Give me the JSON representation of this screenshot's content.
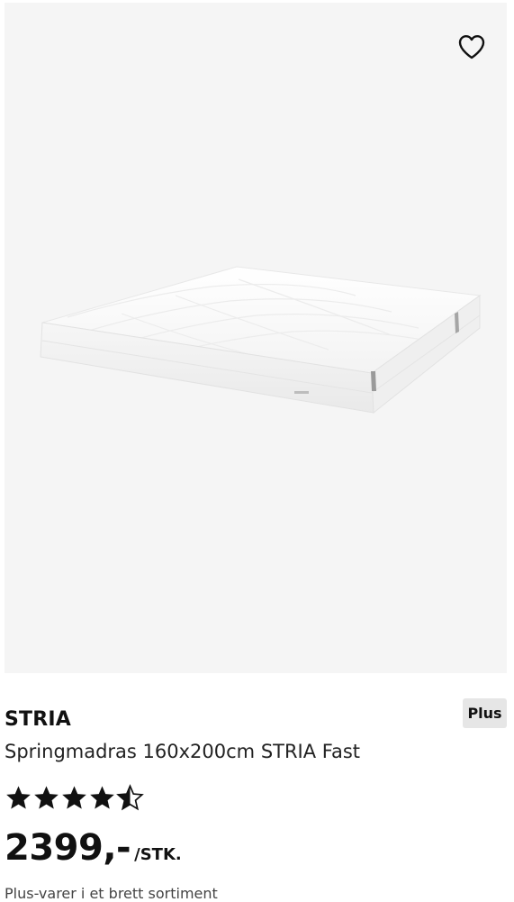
{
  "product": {
    "brand": "STRIA",
    "badge": "Plus",
    "name": "Springmadras 160x200cm STRIA Fast",
    "rating": 4.5,
    "rating_max": 5,
    "price": "2399,-",
    "unit": "/STK.",
    "cutoff_text": "Plus-varer i et brett sortiment"
  },
  "icons": {
    "favorite": "heart-outline-icon",
    "star_full": "star-icon",
    "star_half": "star-half-icon"
  },
  "colors": {
    "image_bg": "#f5f5f5",
    "badge_bg": "#e6e6e6",
    "text": "#111111"
  }
}
